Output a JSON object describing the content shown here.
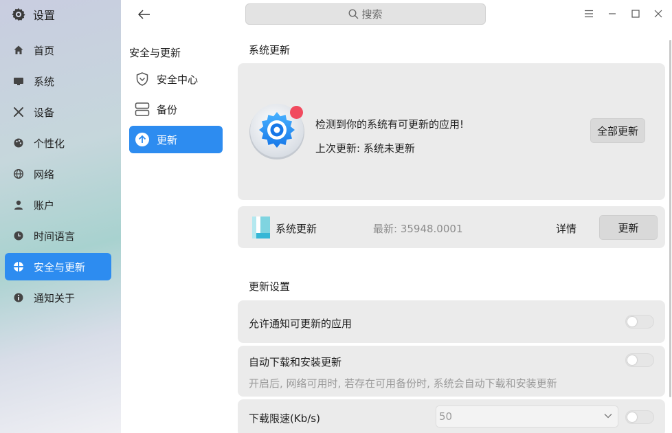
{
  "app": {
    "title": "设置",
    "icon": "gear-icon"
  },
  "sidebar": {
    "items": [
      {
        "label": "首页",
        "icon": "home-icon"
      },
      {
        "label": "系统",
        "icon": "monitor-icon"
      },
      {
        "label": "设备",
        "icon": "tools-icon"
      },
      {
        "label": "个性化",
        "icon": "palette-icon"
      },
      {
        "label": "网络",
        "icon": "globe-icon"
      },
      {
        "label": "账户",
        "icon": "user-icon"
      },
      {
        "label": "时间语言",
        "icon": "clock-icon"
      },
      {
        "label": "安全与更新",
        "icon": "security-icon",
        "active": true
      },
      {
        "label": "通知关于",
        "icon": "info-icon"
      }
    ]
  },
  "middle": {
    "heading": "安全与更新",
    "items": [
      {
        "label": "安全中心",
        "icon": "shield-icon"
      },
      {
        "label": "备份",
        "icon": "backup-icon"
      },
      {
        "label": "更新",
        "icon": "upload-arrow-icon",
        "active": true
      }
    ]
  },
  "search": {
    "placeholder": "搜索"
  },
  "window_controls": [
    "menu-icon",
    "minimize-icon",
    "maximize-icon",
    "close-icon"
  ],
  "system_update": {
    "title": "系统更新",
    "message": "检测到你的系统有可更新的应用!",
    "last_update": "上次更新: 系统未更新",
    "update_all_label": "全部更新",
    "item": {
      "name": "系统更新",
      "latest": "最新: 35948.0001",
      "details_label": "详情",
      "update_label": "更新"
    }
  },
  "update_settings": {
    "title": "更新设置",
    "allow_notify": {
      "label": "允许通知可更新的应用",
      "enabled": false
    },
    "auto_download": {
      "label": "自动下载和安装更新",
      "description": "开启后, 网络可用时, 若存在可用备份时, 系统会自动下载和安装更新",
      "enabled": false
    },
    "speed_limit": {
      "label": "下载限速(Kb/s)",
      "value": "50",
      "enabled": false
    }
  },
  "colors": {
    "accent": "#2d8cf0",
    "badge": "#f14a5e",
    "card": "#ebebeb"
  }
}
